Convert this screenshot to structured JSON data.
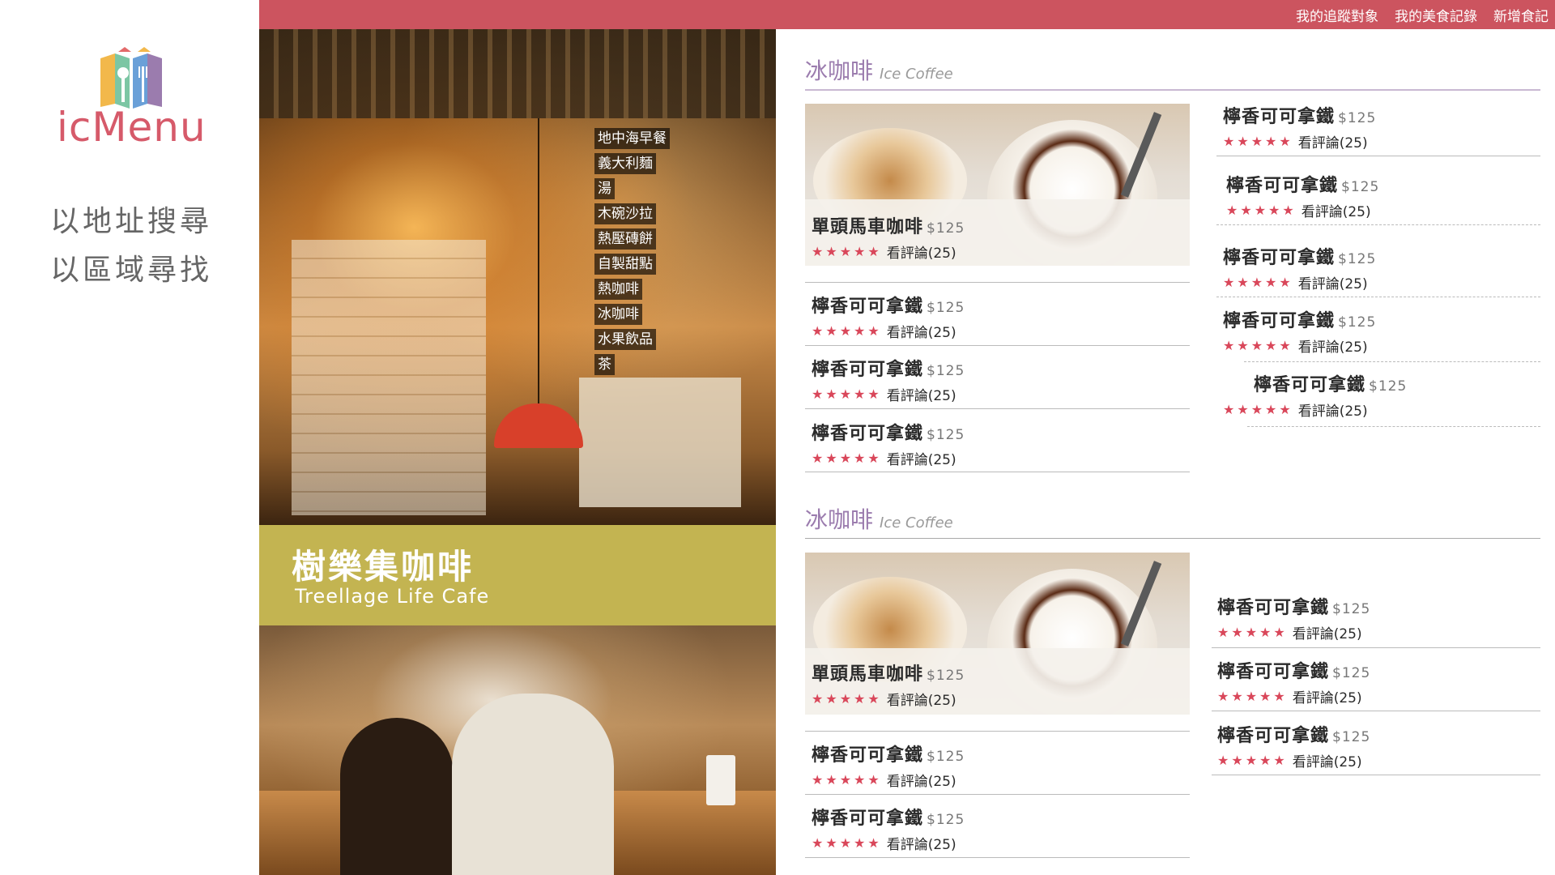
{
  "brand": {
    "name": "icMenu",
    "logo": "book-cutlery-logo",
    "colors": {
      "accent": "#cc545f",
      "title": "#9b7cae"
    }
  },
  "sidebar": {
    "items": [
      {
        "label": "以地址搜尋"
      },
      {
        "label": "以區域尋找"
      }
    ]
  },
  "topbar": {
    "links": [
      {
        "label": "我的追蹤對象"
      },
      {
        "label": "我的美食記錄"
      },
      {
        "label": "新增食記"
      }
    ]
  },
  "restaurant": {
    "name_zh": "樹樂集咖啡",
    "name_en": "Treellage Life Cafe"
  },
  "categories": [
    "地中海早餐",
    "義大利麵",
    "湯",
    "木碗沙拉",
    "熱壓磚餅",
    "自製甜點",
    "熱咖啡",
    "冰咖啡",
    "水果飲品",
    "茶"
  ],
  "sections": [
    {
      "title_zh": "冰咖啡",
      "title_en": "Ice Coffee",
      "feature": {
        "name": "單頭馬車咖啡",
        "price": "$125",
        "stars": "★★★★★",
        "reviews": "看評論(25)"
      },
      "left_items": [
        {
          "name": "檸香可可拿鐵",
          "price": "$125",
          "stars": "★★★★★",
          "reviews": "看評論(25)"
        },
        {
          "name": "檸香可可拿鐵",
          "price": "$125",
          "stars": "★★★★★",
          "reviews": "看評論(25)"
        },
        {
          "name": "檸香可可拿鐵",
          "price": "$125",
          "stars": "★★★★★",
          "reviews": "看評論(25)"
        }
      ],
      "right_items": [
        {
          "name": "檸香可可拿鐵",
          "price": "$125",
          "stars": "★★★★★",
          "reviews": "看評論(25)"
        },
        {
          "name": "檸香可可拿鐵",
          "price": "$125",
          "stars": "★★★★★",
          "reviews": "看評論(25)"
        },
        {
          "name": "檸香可可拿鐵",
          "price": "$125",
          "stars": "★★★★★",
          "reviews": "看評論(25)"
        },
        {
          "name": "檸香可可拿鐵",
          "price": "$125",
          "stars": "★★★★★",
          "reviews": "看評論(25)"
        },
        {
          "name": "檸香可可拿鐵",
          "price": "$125",
          "stars": "★★★★★",
          "reviews": "看評論(25)"
        }
      ]
    },
    {
      "title_zh": "冰咖啡",
      "title_en": "Ice Coffee",
      "feature": {
        "name": "單頭馬車咖啡",
        "price": "$125",
        "stars": "★★★★★",
        "reviews": "看評論(25)"
      },
      "left_items": [
        {
          "name": "檸香可可拿鐵",
          "price": "$125",
          "stars": "★★★★★",
          "reviews": "看評論(25)"
        },
        {
          "name": "檸香可可拿鐵",
          "price": "$125",
          "stars": "★★★★★",
          "reviews": "看評論(25)"
        }
      ],
      "right_items": [
        {
          "name": "檸香可可拿鐵",
          "price": "$125",
          "stars": "★★★★★",
          "reviews": "看評論(25)"
        },
        {
          "name": "檸香可可拿鐵",
          "price": "$125",
          "stars": "★★★★★",
          "reviews": "看評論(25)"
        },
        {
          "name": "檸香可可拿鐵",
          "price": "$125",
          "stars": "★★★★★",
          "reviews": "看評論(25)"
        }
      ]
    }
  ]
}
